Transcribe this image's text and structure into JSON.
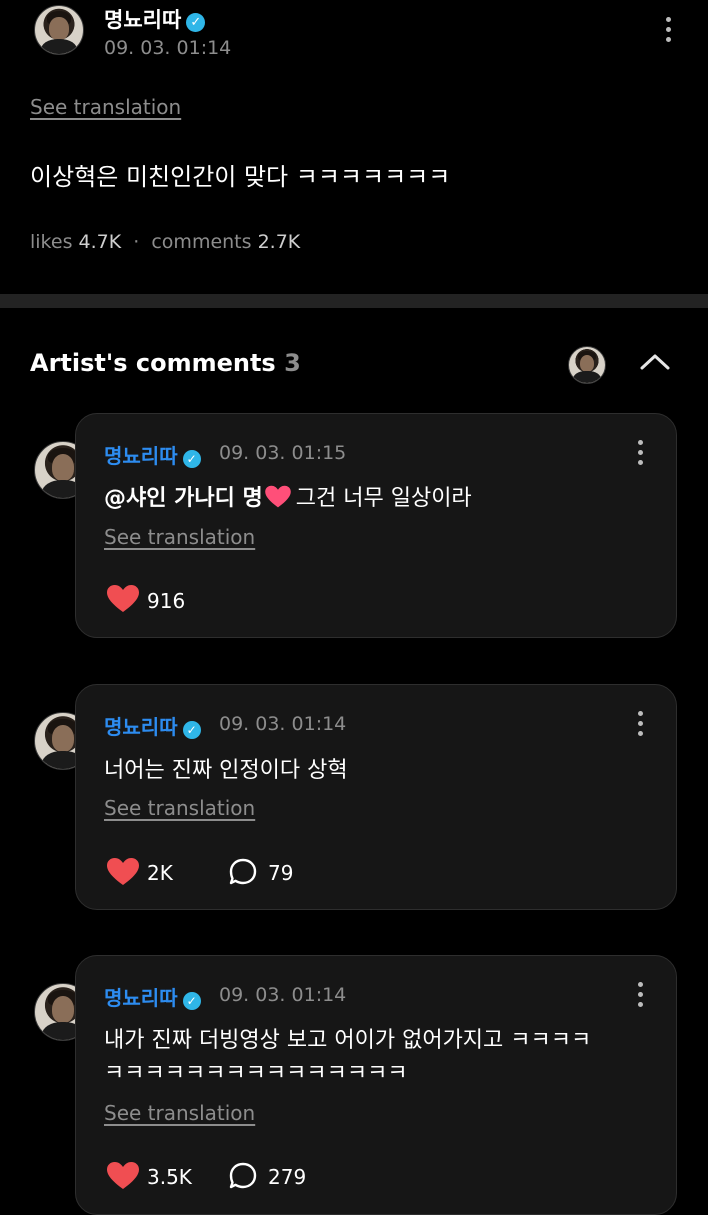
{
  "post": {
    "author": "명뇨리따",
    "time": "09. 03. 01:14",
    "see_translation": "See translation",
    "text": "이상혁은 미친인간이 맞다 ㅋㅋㅋㅋㅋㅋㅋ",
    "likes_label": "likes",
    "likes_value": "4.7K",
    "separator": "·",
    "comments_label": "comments",
    "comments_value": "2.7K"
  },
  "section": {
    "title": "Artist's comments",
    "count": "3"
  },
  "comments": [
    {
      "author": "명뇨리따",
      "time": "09. 03. 01:15",
      "mention": "@샤인 가나디 명",
      "text": "그건 너무 일상이라",
      "see_translation": "See translation",
      "likes": "916"
    },
    {
      "author": "명뇨리따",
      "time": "09. 03. 01:14",
      "text": "너어는 진짜 인정이다 상혁",
      "see_translation": "See translation",
      "likes": "2K",
      "replies": "79"
    },
    {
      "author": "명뇨리따",
      "time": "09. 03. 01:14",
      "text_line1": "내가 진짜 더빙영상 보고 어이가 없어가지고 ㅋㅋㅋㅋ",
      "text_line2": "ㅋㅋㅋㅋㅋㅋㅋㅋㅋㅋㅋㅋㅋㅋㅋ",
      "see_translation": "See translation",
      "likes": "3.5K",
      "replies": "279"
    }
  ],
  "colors": {
    "background": "#000000",
    "card": "#161616",
    "name_blue": "#2d8cf0",
    "verified": "#2fb6e8",
    "heart": "#f04e52",
    "muted": "#8d8d8d"
  },
  "icons": [
    "verified-badge-icon",
    "more-options-icon",
    "chevron-up-icon",
    "heart-icon",
    "comment-bubble-icon",
    "heart-emoji"
  ]
}
